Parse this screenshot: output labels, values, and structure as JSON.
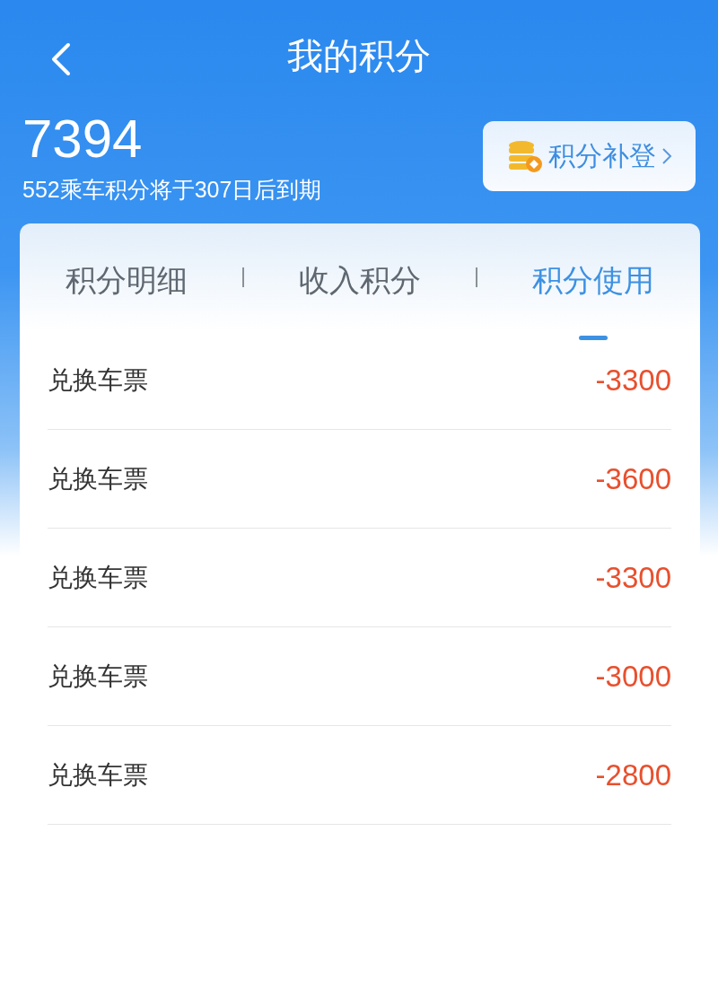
{
  "header": {
    "title": "我的积分"
  },
  "points": {
    "total": "7394",
    "expiry_note": "552乘车积分将于307日后到期"
  },
  "action_button": {
    "label": "积分补登"
  },
  "tabs": [
    {
      "label": "积分明细",
      "selected": false
    },
    {
      "label": "收入积分",
      "selected": false
    },
    {
      "label": "积分使用",
      "selected": true
    }
  ],
  "records": [
    {
      "title": "兑换车票",
      "amount": "-3300"
    },
    {
      "title": "兑换车票",
      "amount": "-3600"
    },
    {
      "title": "兑换车票",
      "amount": "-3300"
    },
    {
      "title": "兑换车票",
      "amount": "-3000"
    },
    {
      "title": "兑换车票",
      "amount": "-2800"
    }
  ]
}
